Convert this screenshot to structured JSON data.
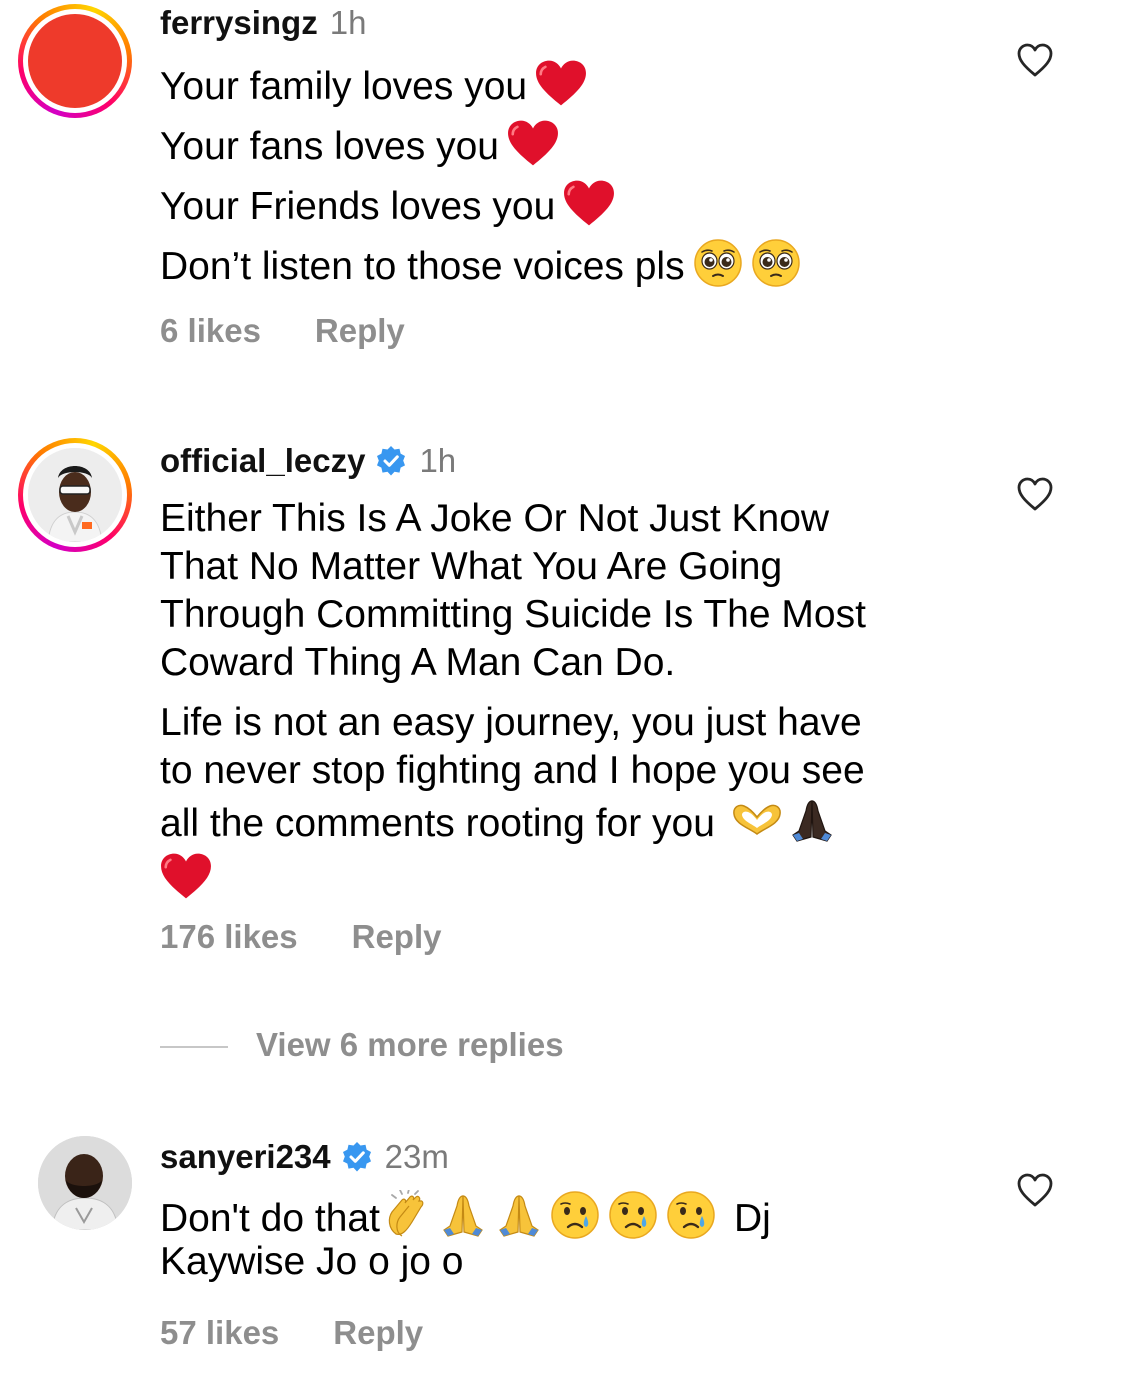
{
  "comments": [
    {
      "username": "ferrysingz",
      "time": "1h",
      "verified": false,
      "lines": [
        "Your family loves you",
        "Your fans loves you",
        "Your Friends loves you",
        "Don’t listen to those voices pls"
      ],
      "likes": "6 likes",
      "reply": "Reply",
      "avatar_color": "#ee3a2b"
    },
    {
      "username": "official_leczy",
      "time": "1h",
      "verified": true,
      "paragraph1": [
        "Either This Is A Joke Or Not Just Know",
        "That No Matter What You Are Going",
        "Through Committing Suicide Is The Most",
        "Coward Thing A Man Can Do."
      ],
      "paragraph2": [
        "Life is not an easy journey, you just have",
        "to never stop fighting and I hope you see",
        "all the comments rooting for you"
      ],
      "likes": "176 likes",
      "reply": "Reply",
      "view_more": "View 6 more replies"
    },
    {
      "username": "sanyeri234",
      "time": "23m",
      "verified": true,
      "line1_start": "Don't do that",
      "line1_end": "Dj",
      "line2": "Kaywise Jo o jo o",
      "likes": "57 likes",
      "reply": "Reply"
    }
  ],
  "icons": {
    "like": "heart-outline-icon",
    "verified": "verified-badge-icon",
    "heart_emoji": "red-heart-emoji",
    "pleading_emoji": "pleading-face-emoji",
    "heart_hands_emoji": "heart-hands-emoji",
    "pray_emoji": "folded-hands-emoji",
    "clap_emoji": "clapping-hands-emoji",
    "cry_emoji": "crying-face-emoji"
  },
  "colors": {
    "secondary_text": "#8e8e8e",
    "verified_blue": "#3897f0",
    "heart_red": "#e0102b"
  }
}
